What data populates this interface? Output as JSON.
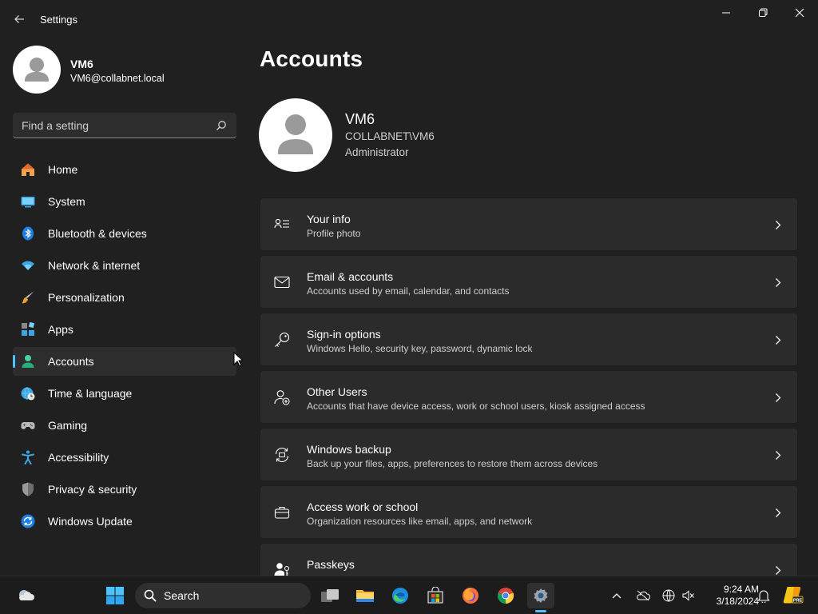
{
  "window": {
    "app_title": "Settings",
    "controls": [
      "minimize",
      "restore",
      "close"
    ]
  },
  "profile": {
    "name": "VM6",
    "email": "VM6@collabnet.local"
  },
  "search": {
    "placeholder": "Find a setting"
  },
  "nav": {
    "active": "Accounts",
    "items": [
      {
        "label": "Home",
        "icon": "home-icon"
      },
      {
        "label": "System",
        "icon": "system-icon"
      },
      {
        "label": "Bluetooth & devices",
        "icon": "bluetooth-icon"
      },
      {
        "label": "Network & internet",
        "icon": "wifi-icon"
      },
      {
        "label": "Personalization",
        "icon": "brush-icon"
      },
      {
        "label": "Apps",
        "icon": "apps-icon"
      },
      {
        "label": "Accounts",
        "icon": "accounts-icon"
      },
      {
        "label": "Time & language",
        "icon": "globe-clock-icon"
      },
      {
        "label": "Gaming",
        "icon": "gamepad-icon"
      },
      {
        "label": "Accessibility",
        "icon": "accessibility-icon"
      },
      {
        "label": "Privacy & security",
        "icon": "shield-icon"
      },
      {
        "label": "Windows Update",
        "icon": "update-icon"
      }
    ]
  },
  "main": {
    "title": "Accounts",
    "account": {
      "name": "VM6",
      "domain": "COLLABNET\\VM6",
      "role": "Administrator"
    },
    "cards": [
      {
        "title": "Your info",
        "subtitle": "Profile photo",
        "icon": "person-info-icon"
      },
      {
        "title": "Email & accounts",
        "subtitle": "Accounts used by email, calendar, and contacts",
        "icon": "mail-icon"
      },
      {
        "title": "Sign-in options",
        "subtitle": "Windows Hello, security key, password, dynamic lock",
        "icon": "key-icon"
      },
      {
        "title": "Other Users",
        "subtitle": "Accounts that have device access, work or school users, kiosk assigned access",
        "icon": "add-user-icon"
      },
      {
        "title": "Windows backup",
        "subtitle": "Back up your files, apps, preferences to restore them across devices",
        "icon": "backup-icon"
      },
      {
        "title": "Access work or school",
        "subtitle": "Organization resources like email, apps, and network",
        "icon": "briefcase-icon"
      },
      {
        "title": "Passkeys",
        "subtitle": "",
        "icon": "passkey-icon"
      }
    ]
  },
  "taskbar": {
    "search_label": "Search",
    "apps": [
      "start-icon",
      "task-view-icon",
      "file-explorer-icon",
      "edge-icon",
      "store-icon",
      "firefox-icon",
      "chrome-icon",
      "settings-icon"
    ],
    "clock_time": "9:24 AM",
    "clock_date": "3/18/2024",
    "tray_badge": "PRE"
  },
  "colors": {
    "background": "#202020",
    "card": "#2b2b2b",
    "accent": "#4cc2ff"
  }
}
